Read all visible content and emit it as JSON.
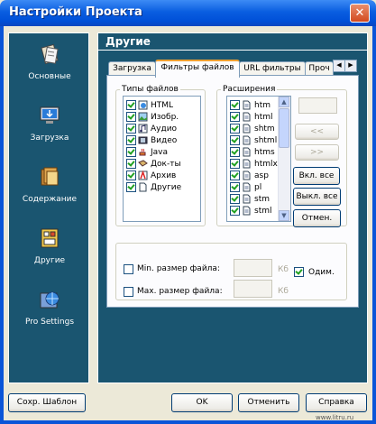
{
  "window": {
    "title": "Настройки Проекта",
    "close_symbol": "✕"
  },
  "nav": {
    "items": [
      {
        "label": "Основные",
        "icon": "general-settings-icon"
      },
      {
        "label": "Загрузка",
        "icon": "download-icon"
      },
      {
        "label": "Содержание",
        "icon": "content-files-icon"
      },
      {
        "label": "Другие",
        "icon": "other-settings-icon"
      },
      {
        "label": "Pro Settings",
        "icon": "pro-settings-globe-icon"
      }
    ]
  },
  "page": {
    "header": "Другие"
  },
  "tabs": [
    {
      "label": "Загрузка",
      "active": false
    },
    {
      "label": "Фильтры файлов",
      "active": true
    },
    {
      "label": "URL фильтры",
      "active": false
    },
    {
      "label": "Проч",
      "active": false
    }
  ],
  "tab_scroll": {
    "left": "◀",
    "right": "▶"
  },
  "file_types": {
    "legend": "Типы файлов",
    "items": [
      {
        "label": "HTML",
        "checked": true,
        "icon": "html-page-icon"
      },
      {
        "label": "Изобр.",
        "checked": true,
        "icon": "image-icon"
      },
      {
        "label": "Аудио",
        "checked": true,
        "icon": "audio-icon"
      },
      {
        "label": "Видео",
        "checked": true,
        "icon": "video-icon"
      },
      {
        "label": "Java",
        "checked": true,
        "icon": "java-icon"
      },
      {
        "label": "Док-ты",
        "checked": true,
        "icon": "documents-icon"
      },
      {
        "label": "Архив",
        "checked": true,
        "icon": "archive-icon"
      },
      {
        "label": "Другие",
        "checked": true,
        "icon": "other-files-icon"
      }
    ]
  },
  "extensions": {
    "legend": "Расширения",
    "items": [
      {
        "label": "htm",
        "checked": true
      },
      {
        "label": "html",
        "checked": true
      },
      {
        "label": "shtm",
        "checked": true
      },
      {
        "label": "shtml",
        "checked": true
      },
      {
        "label": "htms",
        "checked": true
      },
      {
        "label": "htmlx",
        "checked": true
      },
      {
        "label": "asp",
        "checked": true
      },
      {
        "label": "pl",
        "checked": true
      },
      {
        "label": "stm",
        "checked": true
      },
      {
        "label": "stml",
        "checked": true
      }
    ],
    "input_value": "",
    "add_label": "<<",
    "remove_label": ">>",
    "enable_all_label": "Вкл. все",
    "disable_all_label": "Выкл. все",
    "cancel_label": "Отмен."
  },
  "size": {
    "min_label": "Min. размер файла:",
    "min_checked": false,
    "min_value": "",
    "max_label": "Max. размер файла:",
    "max_checked": false,
    "max_value": "",
    "unit": "Кб",
    "same_label": "Одим.",
    "same_checked": true
  },
  "footer": {
    "save_template": "Сохр. Шаблон",
    "ok": "OK",
    "cancel": "Отменить",
    "help": "Справка"
  },
  "watermark": "www.litru.ru"
}
